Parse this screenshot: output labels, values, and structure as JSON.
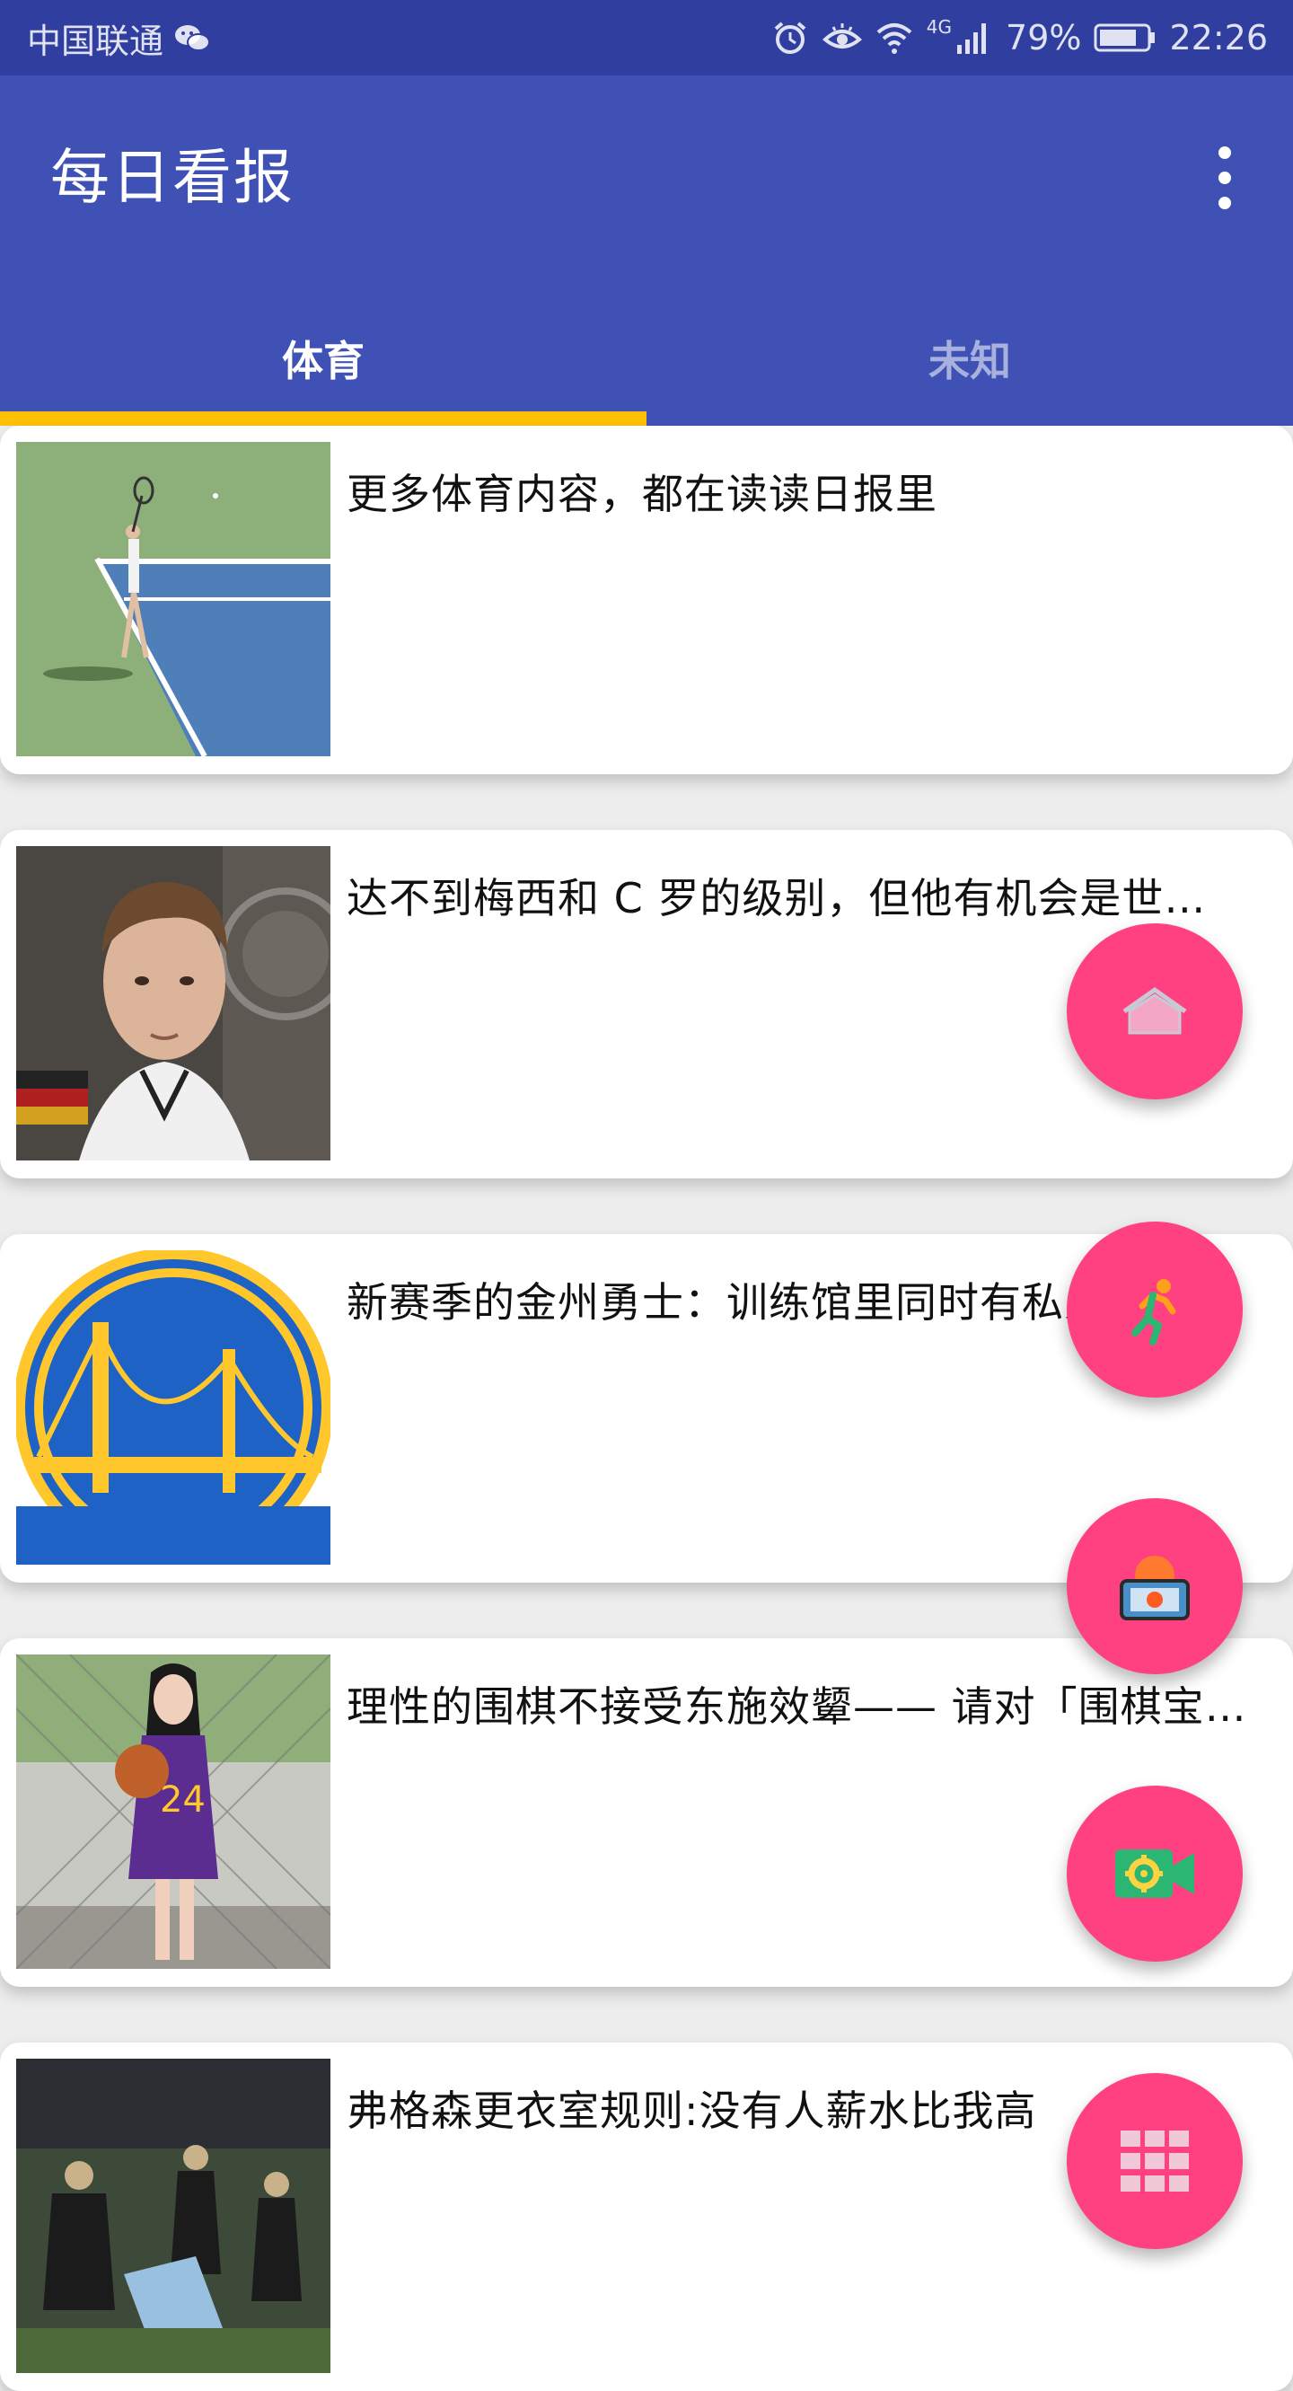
{
  "status_bar": {
    "carrier": "中国联通",
    "network": "4G",
    "battery": "79%",
    "time": "22:26"
  },
  "app_bar": {
    "title": "每日看报"
  },
  "tabs": [
    {
      "label": "体育",
      "selected": true
    },
    {
      "label": "未知",
      "selected": false
    }
  ],
  "news": [
    {
      "title": "更多体育内容，都在读读日报里",
      "image": "tennis-photo"
    },
    {
      "title": "达不到梅西和 C 罗的级别，但他有机会是世…",
      "image": "player-portrait-photo"
    },
    {
      "title": "新赛季的金州勇士：训练馆里同时有私人教练…",
      "image": "warriors-logo"
    },
    {
      "title": "理性的围棋不接受东施效颦—— 请对「围棋宝…",
      "image": "basketball-girl-photo"
    },
    {
      "title": "弗格森更衣室规则:没有人薪水比我高",
      "image": "football-match-photo"
    }
  ],
  "fabs": [
    "home-icon",
    "running-icon",
    "camera-flip-icon",
    "video-settings-icon",
    "grid-menu-icon"
  ],
  "colors": {
    "status_bar": "#303f9f",
    "app_bar": "#3f51b5",
    "indicator": "#ffc107",
    "fab": "#ff4081"
  }
}
